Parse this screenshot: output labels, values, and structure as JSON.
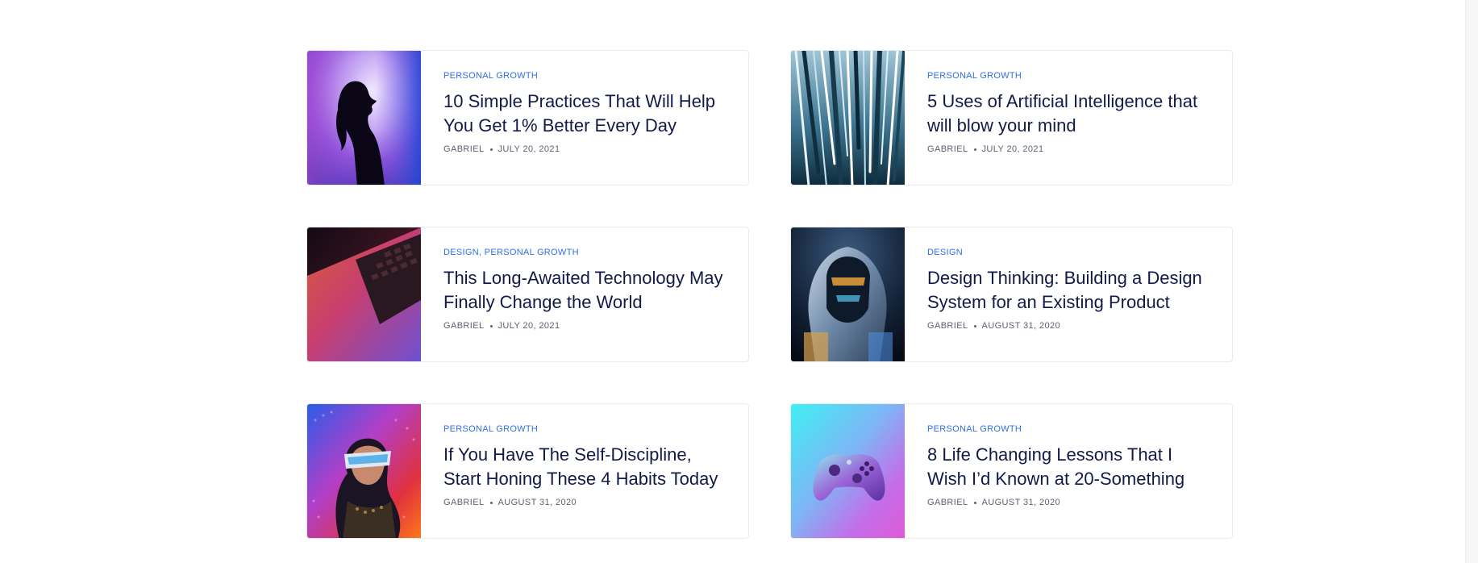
{
  "posts": [
    {
      "category": "PERSONAL GROWTH",
      "title": "10 Simple Practices That Will Help You Get 1% Better Every Day",
      "author": "GABRIEL",
      "date": "JULY 20, 2021"
    },
    {
      "category": "PERSONAL GROWTH",
      "title": "5 Uses of Artificial Intelligence that will blow your mind",
      "author": "GABRIEL",
      "date": "JULY 20, 2021"
    },
    {
      "category": "DESIGN, PERSONAL GROWTH",
      "title": "This Long-Awaited Technology May Finally Change the World",
      "author": "GABRIEL",
      "date": "JULY 20, 2021"
    },
    {
      "category": "DESIGN",
      "title": "Design Thinking: Building a Design System for an Existing Product",
      "author": "GABRIEL",
      "date": "AUGUST 31, 2020"
    },
    {
      "category": "PERSONAL GROWTH",
      "title": "If You Have The Self-Discipline, Start Honing These 4 Habits Today",
      "author": "GABRIEL",
      "date": "AUGUST 31, 2020"
    },
    {
      "category": "PERSONAL GROWTH",
      "title": "8 Life Changing Lessons That I Wish I’d Known at 20-Something",
      "author": "GABRIEL",
      "date": "AUGUST 31, 2020"
    }
  ],
  "images": [
    {
      "icon": "silhouette-woman-image"
    },
    {
      "icon": "light-streaks-image"
    },
    {
      "icon": "laptop-keyboard-image"
    },
    {
      "icon": "astronaut-helmet-image"
    },
    {
      "icon": "woman-vr-glasses-image"
    },
    {
      "icon": "game-controller-image"
    }
  ],
  "colors": {
    "category": "#2f6fea",
    "title": "#121a4a",
    "meta": "#5d6172",
    "border": "#ebebee"
  }
}
